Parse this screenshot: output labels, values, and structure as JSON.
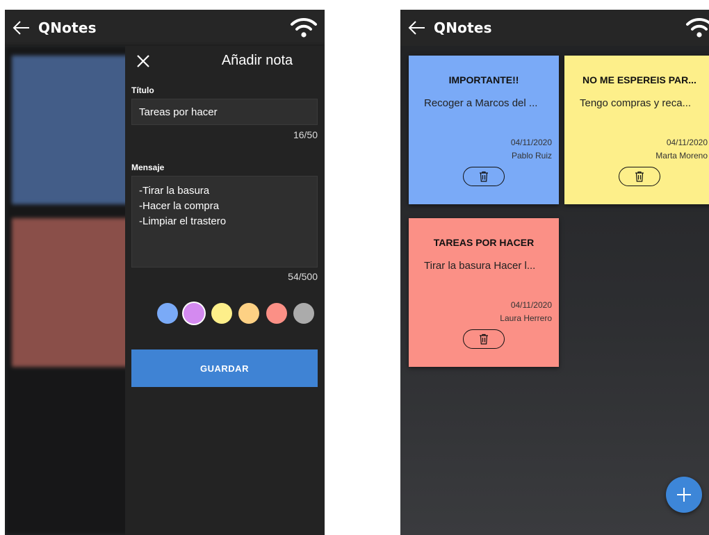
{
  "app": {
    "title": "QNotes"
  },
  "colors": {
    "blue": "#7aaaf7",
    "purple": "#d48af0",
    "yellow": "#fdef8a",
    "orange": "#fdd184",
    "red": "#fb9086",
    "grey": "#ababab",
    "accent": "#3f83d4",
    "appbar": "#262626"
  },
  "icons": {
    "back": "arrow-left-icon",
    "wifi": "wifi-icon",
    "close": "close-icon",
    "delete": "trash-icon",
    "add": "plus-icon"
  },
  "notes": [
    {
      "title": "IMPORTANTE!!",
      "message": "Recoger a Marcos del ...",
      "date": "04/11/2020",
      "author": "Pablo Ruiz",
      "color": "#7aaaf7"
    },
    {
      "title": "NO ME ESPEREIS PAR...",
      "message": "Tengo compras y reca...",
      "date": "04/11/2020",
      "author": "Marta Moreno",
      "color": "#fdef8a"
    },
    {
      "title": "TAREAS POR HACER",
      "message": "Tirar la basura Hacer l...",
      "date": "04/11/2020",
      "author": "Laura Herrero",
      "color": "#fb9086"
    }
  ],
  "add_note": {
    "title": "Añadir nota",
    "title_label": "Título",
    "title_value": "Tareas por hacer",
    "title_counter": "16/50",
    "message_label": "Mensaje",
    "message_lines": [
      "-Tirar la basura",
      "-Hacer la compra",
      "-Limpiar el trastero"
    ],
    "message_counter": "54/500",
    "color_options": [
      "#7aaaf7",
      "#d48af0",
      "#fdef8a",
      "#fdd184",
      "#fb9086",
      "#ababab"
    ],
    "selected_color": "#d48af0",
    "save_label": "GUARDAR"
  }
}
